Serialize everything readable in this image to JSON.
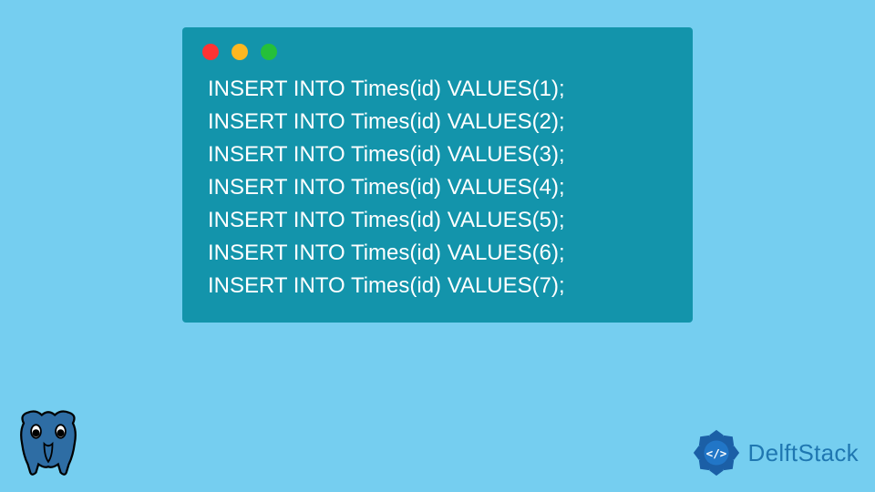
{
  "code": {
    "lines": [
      "INSERT INTO Times(id) VALUES(1);",
      "INSERT INTO Times(id) VALUES(2);",
      "INSERT INTO Times(id) VALUES(3);",
      "INSERT INTO Times(id) VALUES(4);",
      "INSERT INTO Times(id) VALUES(5);",
      "INSERT INTO Times(id) VALUES(6);",
      "INSERT INTO Times(id) VALUES(7);"
    ]
  },
  "brand": {
    "name": "DelftStack"
  },
  "colors": {
    "background": "#75cef0",
    "window": "#1394ab",
    "code_text": "#ffffff",
    "brand_text": "#1f77b1"
  }
}
